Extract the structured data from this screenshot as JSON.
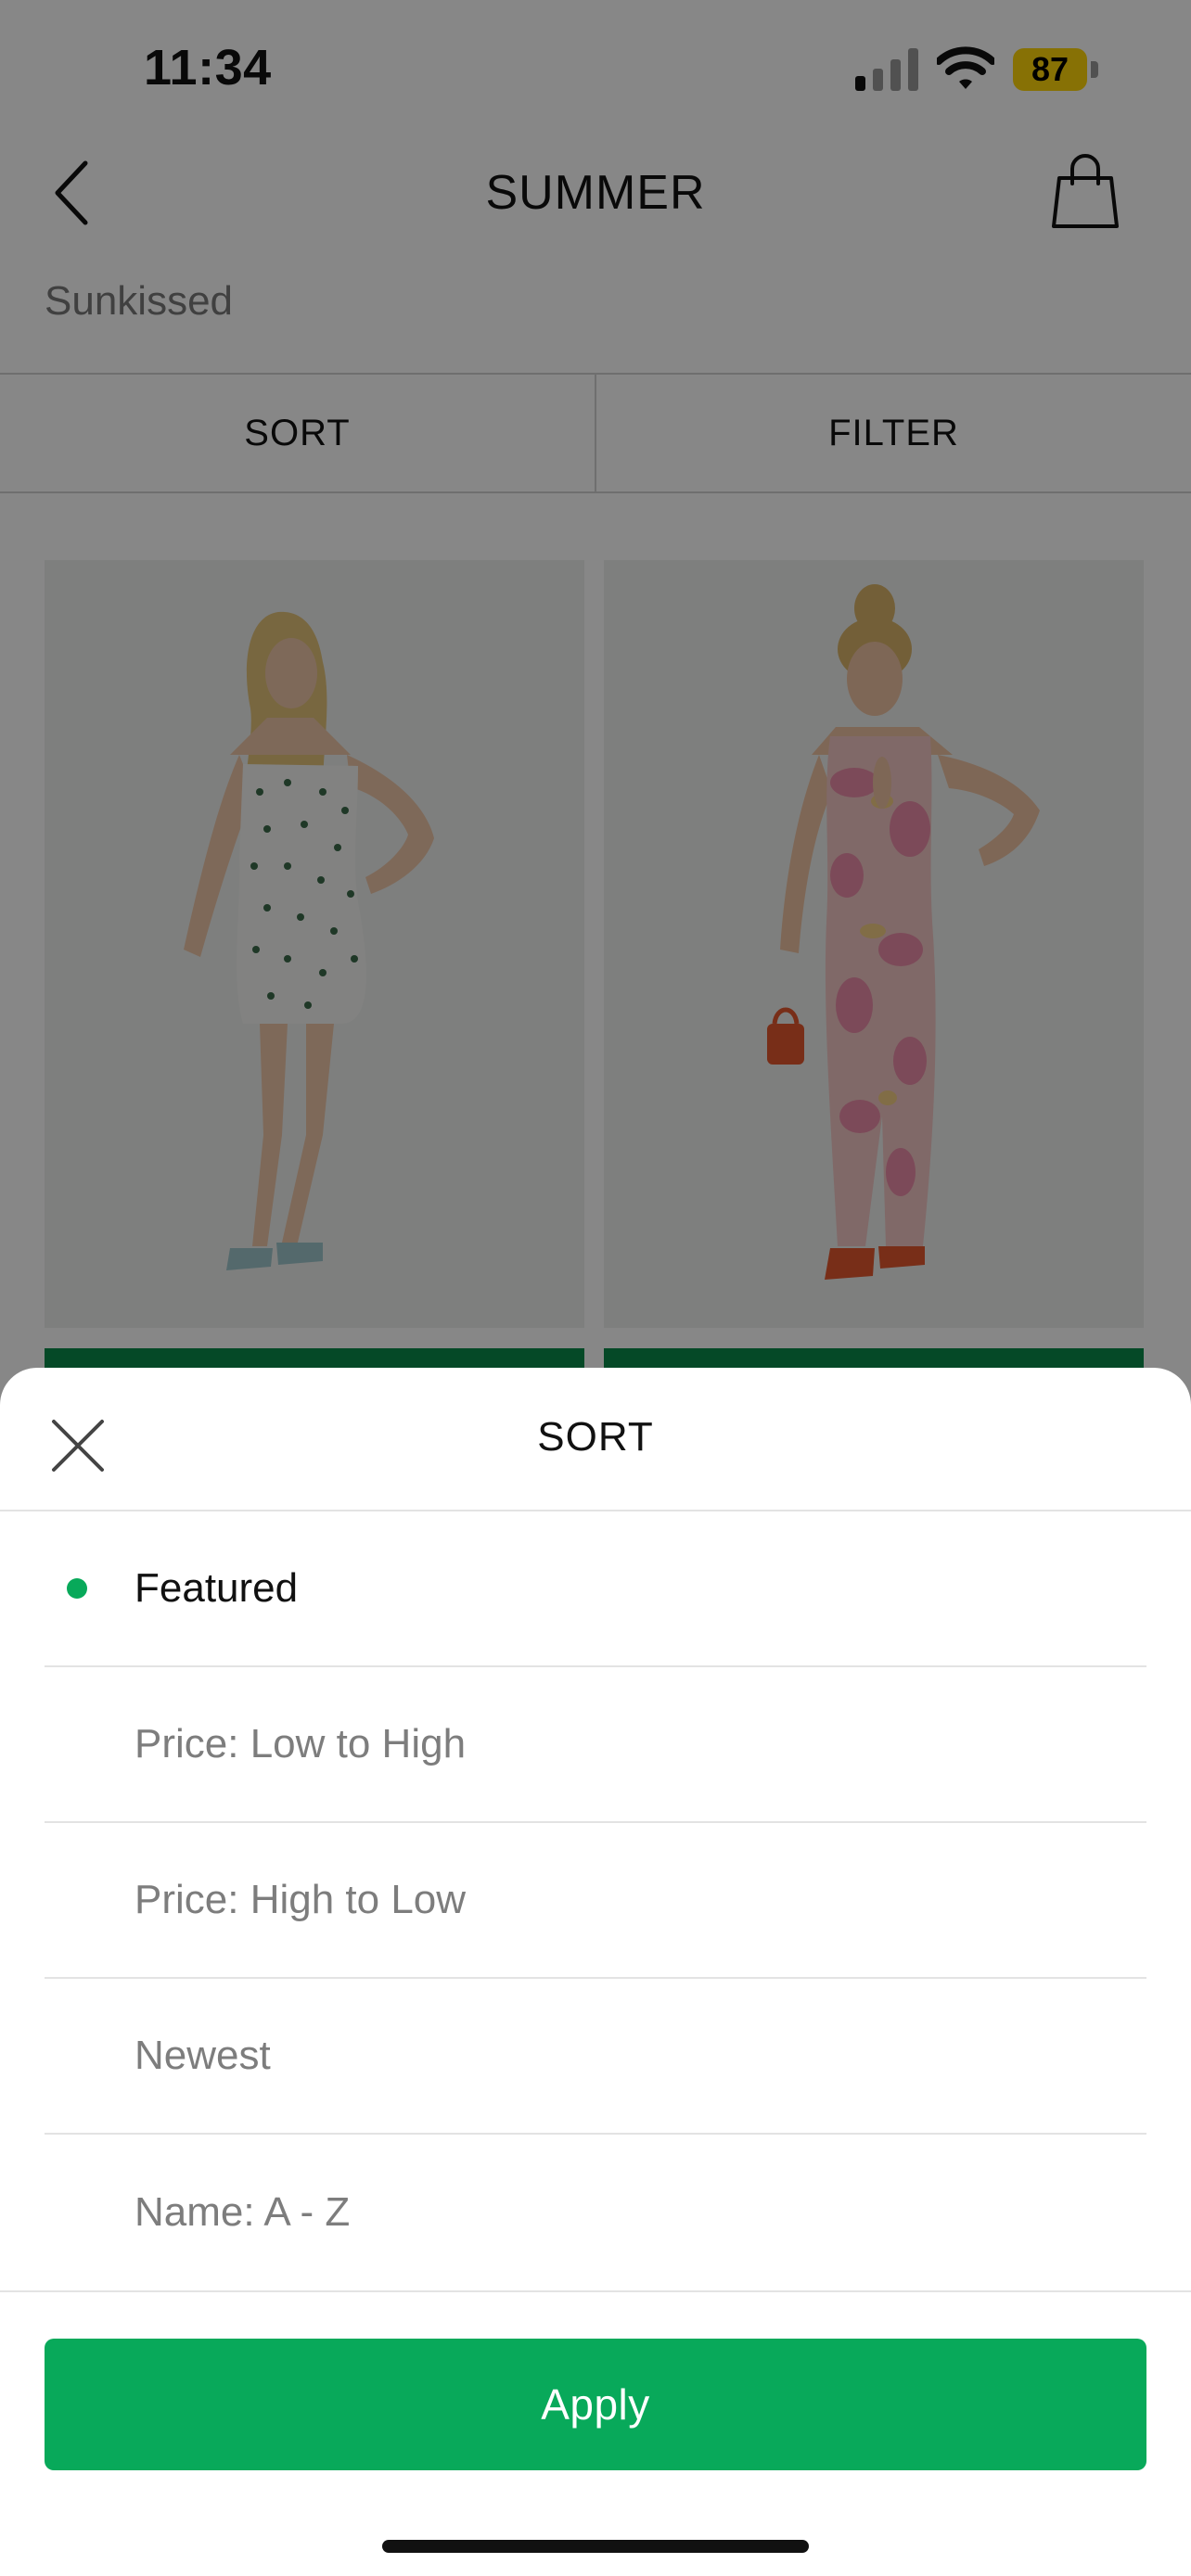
{
  "status_bar": {
    "time": "11:34",
    "battery_level": "87"
  },
  "header": {
    "title": "SUMMER",
    "subtitle": "Sunkissed",
    "icons": [
      "chevron-left-icon",
      "shopping-bag-icon"
    ]
  },
  "toolbar": {
    "sort_label": "SORT",
    "filter_label": "FILTER"
  },
  "products": [
    {
      "image": "model in white floral strapless mini dress"
    },
    {
      "image": "model in pink tie-dye cut-out midi dress"
    }
  ],
  "sort_sheet": {
    "title": "SORT",
    "close_icon": "close-icon",
    "options": [
      {
        "label": "Featured",
        "selected": true
      },
      {
        "label": "Price: Low to High",
        "selected": false
      },
      {
        "label": "Price: High to Low",
        "selected": false
      },
      {
        "label": "Newest",
        "selected": false
      },
      {
        "label": "Name: A - Z",
        "selected": false
      }
    ],
    "apply_label": "Apply"
  },
  "colors": {
    "accent": "#08a95a",
    "product_bar": "#0a8a4b",
    "battery": "#ffd60a"
  }
}
